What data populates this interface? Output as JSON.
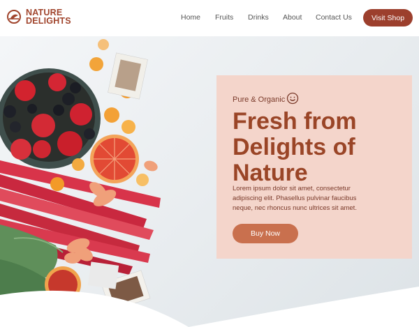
{
  "brand": {
    "line1": "NATURE",
    "line2": "DELIGHTS",
    "logo_icon": "leaf-circle-icon",
    "color": "#a0442c"
  },
  "nav": {
    "items": [
      "Home",
      "Fruits",
      "Drinks",
      "About",
      "Contact Us"
    ],
    "cta_label": "Visit Shop"
  },
  "hero": {
    "eyebrow": "Pure & Organic",
    "eyebrow_icon": "smiley-icon",
    "headline": "Fresh from Delights of Nature",
    "body": "Lorem ipsum dolor sit amet, consectetur adipiscing elit. Phasellus pulvinar faucibus neque, nec rhoncus nunc ultrices sit amet.",
    "button_label": "Buy Now",
    "image": "fruit-bowl-rhubarb-photo",
    "colors": {
      "panel": "#f4d5cb",
      "headline": "#9a4527",
      "button": "#c9704e",
      "cta": "#9c3f2d"
    }
  }
}
